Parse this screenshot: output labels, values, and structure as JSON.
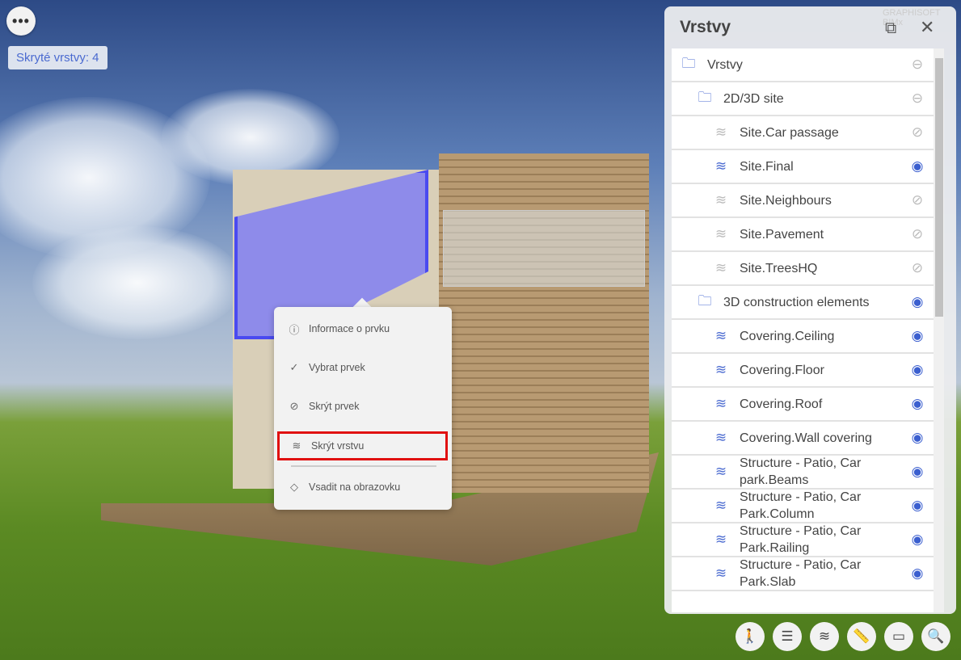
{
  "top": {
    "more_label": "•••",
    "hidden_layers": "Skryté vrstvy: 4"
  },
  "context_menu": {
    "items": [
      {
        "label": "Informace o prvku",
        "icon": "info-icon"
      },
      {
        "label": "Vybrat prvek",
        "icon": "check-circle-icon"
      },
      {
        "label": "Skrýt prvek",
        "icon": "eye-off-icon"
      },
      {
        "label": "Skrýt vrstvu",
        "icon": "layers-icon",
        "highlighted": true
      },
      {
        "label": "Vsadit na obrazovku",
        "icon": "fit-screen-icon"
      }
    ]
  },
  "panel": {
    "title": "Vrstvy",
    "logo": "GRAPHISOFT BIMx",
    "rows": [
      {
        "label": "Vrstvy",
        "type": "root",
        "visibility": "partial"
      },
      {
        "label": "2D/3D site",
        "type": "folder",
        "visibility": "partial"
      },
      {
        "label": "Site.Car passage",
        "type": "layer",
        "visibility": "hidden"
      },
      {
        "label": "Site.Final",
        "type": "layer",
        "visibility": "visible"
      },
      {
        "label": "Site.Neighbours",
        "type": "layer",
        "visibility": "hidden"
      },
      {
        "label": "Site.Pavement",
        "type": "layer",
        "visibility": "hidden"
      },
      {
        "label": "Site.TreesHQ",
        "type": "layer",
        "visibility": "hidden"
      },
      {
        "label": "3D construction elements",
        "type": "folder",
        "visibility": "visible"
      },
      {
        "label": "Covering.Ceiling",
        "type": "layer",
        "visibility": "visible"
      },
      {
        "label": "Covering.Floor",
        "type": "layer",
        "visibility": "visible"
      },
      {
        "label": "Covering.Roof",
        "type": "layer",
        "visibility": "visible"
      },
      {
        "label": "Covering.Wall covering",
        "type": "layer",
        "visibility": "visible"
      },
      {
        "label": "Structure - Patio, Car park.Beams",
        "type": "layer",
        "visibility": "visible"
      },
      {
        "label": "Structure - Patio, Car Park.Column",
        "type": "layer",
        "visibility": "visible"
      },
      {
        "label": "Structure - Patio, Car Park.Railing",
        "type": "layer",
        "visibility": "visible"
      },
      {
        "label": "Structure - Patio, Car Park.Slab",
        "type": "layer",
        "visibility": "visible"
      }
    ]
  },
  "toolbar": [
    "walk-icon",
    "settings-sliders-icon",
    "layers-icon",
    "ruler-icon",
    "sheet-icon",
    "zoom-view-icon"
  ]
}
